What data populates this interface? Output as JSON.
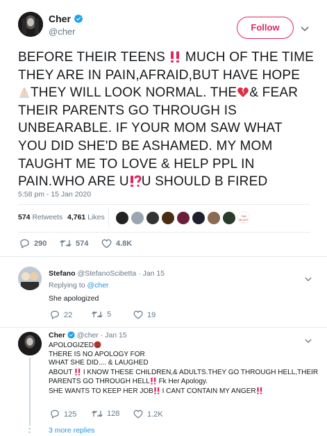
{
  "tweet": {
    "author_name": "Cher",
    "author_handle": "@cher",
    "follow_label": "Follow",
    "text_lines": [
      "BEFORE THEIR TEENS",
      "MUCH OF THE TIME",
      "THEY ARE IN PAIN,AFRAID,BUT HAVE HOPE",
      "THEY WILL LOOK NORMAL. THE",
      "& FEAR",
      "THEIR PARENTS GO THROUGH IS",
      "UNBEARABLE. IF YOUR MOM SAW WHAT",
      "YOU DID SHE'D BE ASHAMED. MY MOM",
      "TAUGHT ME TO LOVE & HELP PPL IN",
      "PAIN.WHO ARE U",
      "U SHOULD B FIRED"
    ],
    "timestamp": "5:58 pm - 15 Jan 2020",
    "retweets_count": "574",
    "retweets_label": "Retweets",
    "likes_count": "4,761",
    "likes_label": "Likes",
    "liker_watermark": "THE BLUNT POST",
    "actions": {
      "replies": "290",
      "retweets": "574",
      "likes": "4.8K"
    }
  },
  "replies": [
    {
      "name": "Stefano",
      "handle": "@StefanoScibetta",
      "date": "· Jan 15",
      "replying_label": "Replying to",
      "replying_to": "@cher",
      "text": "She apologized",
      "actions": {
        "replies": "22",
        "retweets": "5",
        "likes": "19"
      }
    },
    {
      "name": "Cher",
      "handle": "@cher",
      "date": "· Jan 15",
      "lines": [
        "APOLOGIZED",
        "THERE IS NO APOLOGY FOR",
        "WHAT SHE DID.... & LAUGHED",
        "ABOUT",
        "I KNOW THESE CHILDREN,& ADULTS.THEY GO THROUGH HELL,THEIR",
        "PARENTS GO THROUGH HELL",
        "Fk Her Apology.",
        "SHE WANTS TO KEEP HER JOB",
        "I CANT CONTAIN MY ANGER"
      ],
      "actions": {
        "replies": "125",
        "retweets": "128",
        "likes": "1.2K"
      }
    }
  ],
  "more_replies": "3 more replies",
  "colors": {
    "accent": "#1b95e0",
    "follow": "#e0245e",
    "muted": "#657786",
    "emoji_red": "#e0245e"
  }
}
